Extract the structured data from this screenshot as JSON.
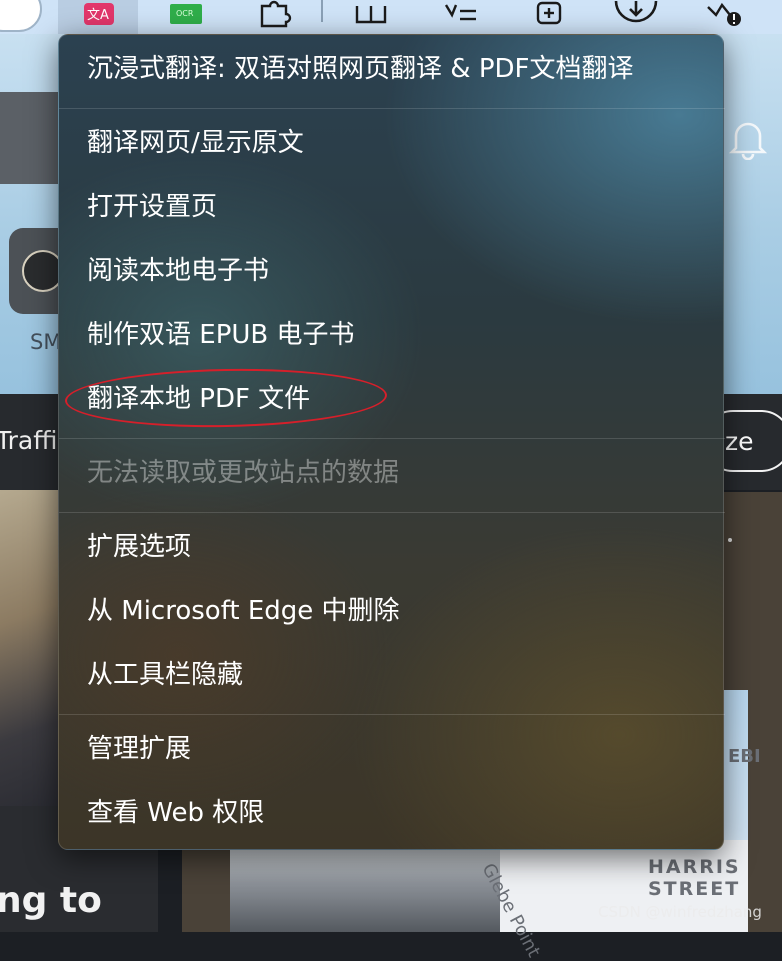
{
  "menu": {
    "title": "沉浸式翻译: 双语对照网页翻译 & PDF文档翻译",
    "group1": [
      "翻译网页/显示原文",
      "打开设置页",
      "阅读本地电子书",
      "制作双语 EPUB 电子书",
      "翻译本地 PDF 文件"
    ],
    "site_data": "无法读取或更改站点的数据",
    "group2": [
      "扩展选项",
      "从 Microsoft Edge 中删除",
      "从工具栏隐藏"
    ],
    "group3": [
      "管理扩展",
      "查看 Web 权限"
    ]
  },
  "toolbar": {
    "icons": [
      "translate-extension-icon",
      "ocr-extension-icon",
      "puzzle-extensions-icon",
      "split-screen-icon",
      "favorites-list-icon",
      "collections-icon",
      "downloads-icon",
      "browser-essentials-icon"
    ],
    "active_color": "#b9cde2"
  },
  "background": {
    "side_label": "SM",
    "traffic_label": "Traffic",
    "customize_label": "ize",
    "headline_fragment": "ng to",
    "map_label": "HARRIS STREET",
    "map_street": "Glebe Point",
    "map_edge": "EBI"
  },
  "annotation": {
    "highlight_color": "#d61f2a"
  },
  "watermark": "CSDN @winfredzhang"
}
